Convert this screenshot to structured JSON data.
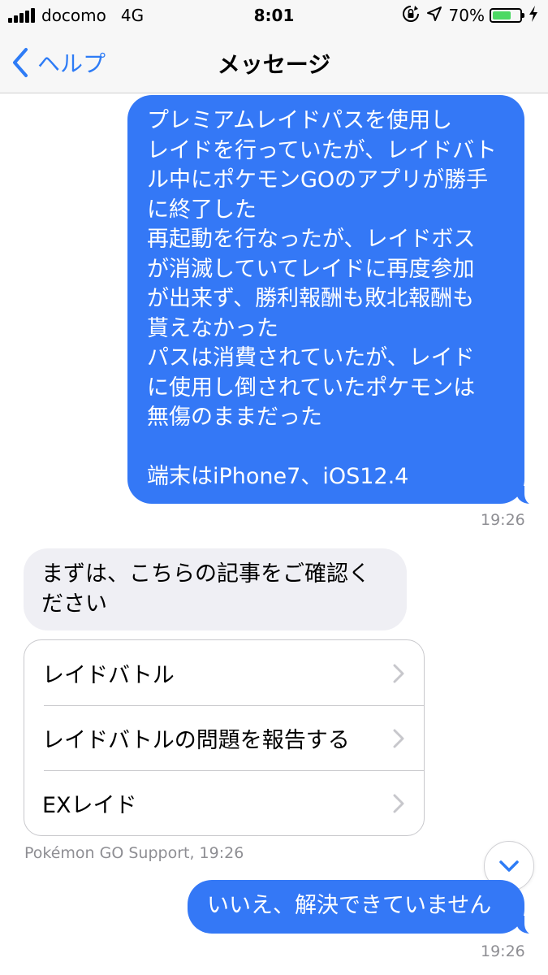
{
  "status_bar": {
    "carrier": "docomo",
    "network": "4G",
    "time": "8:01",
    "battery_percent_label": "70%",
    "battery_level": 0.7,
    "battery_color": "#4cd964"
  },
  "nav": {
    "back_label": "ヘルプ",
    "title": "メッセージ"
  },
  "messages": [
    {
      "direction": "outgoing",
      "text": "プレミアムレイドパスを使用し\nレイドを行っていたが、レイドバト\nル中にポケモンGOのアプリが勝手\nに終了した\n再起動を行なったが、レイドボス\nが消滅していてレイドに再度参加\nが出来ず、勝利報酬も敗北報酬も\n貰えなかった\nパスは消費されていたが、レイド\nに使用し倒されていたポケモンは\n無傷のままだった\n\n端末はiPhone7、iOS12.4",
      "time": "19:26"
    },
    {
      "direction": "incoming",
      "text": "まずは、こちらの記事をご確認く\nださい"
    },
    {
      "direction": "outgoing",
      "text": "いいえ、解決できていません",
      "time": "19:26"
    }
  ],
  "articles": [
    {
      "label": "レイドバトル"
    },
    {
      "label": "レイドバトルの問題を報告する"
    },
    {
      "label": "EXレイド"
    }
  ],
  "sender_label": "Pokémon GO Support, 19:26",
  "icons": {
    "back": "chevron-left-icon",
    "article_chevron": "chevron-right-icon",
    "scroll_down": "chevron-down-icon",
    "orientation_lock": "orientation-lock-icon",
    "location": "location-arrow-icon",
    "charging": "bolt-icon"
  },
  "colors": {
    "accent": "#2e7cf6",
    "outgoing_bubble": "#3478f6",
    "incoming_bubble": "#efeff4",
    "meta_text": "#8e8e93"
  }
}
